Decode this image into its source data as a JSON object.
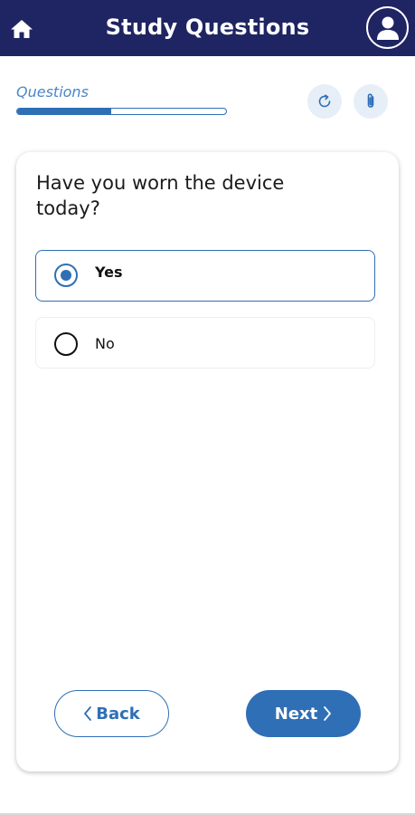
{
  "header": {
    "title": "Study Questions",
    "home_icon": "home-icon",
    "profile_icon": "user-avatar-icon",
    "background_color": "#1f2463"
  },
  "progress": {
    "label": "Questions",
    "fraction": 0.45,
    "refresh_icon": "refresh-icon",
    "attach_icon": "paperclip-icon"
  },
  "question": {
    "text": "Have you worn the device today?",
    "options": [
      {
        "label": "Yes",
        "selected": true
      },
      {
        "label": "No",
        "selected": false
      }
    ]
  },
  "navigation": {
    "back_label": "Back",
    "next_label": "Next"
  },
  "colors": {
    "accent": "#2f6fb5",
    "progress_label": "#4a86c8"
  }
}
